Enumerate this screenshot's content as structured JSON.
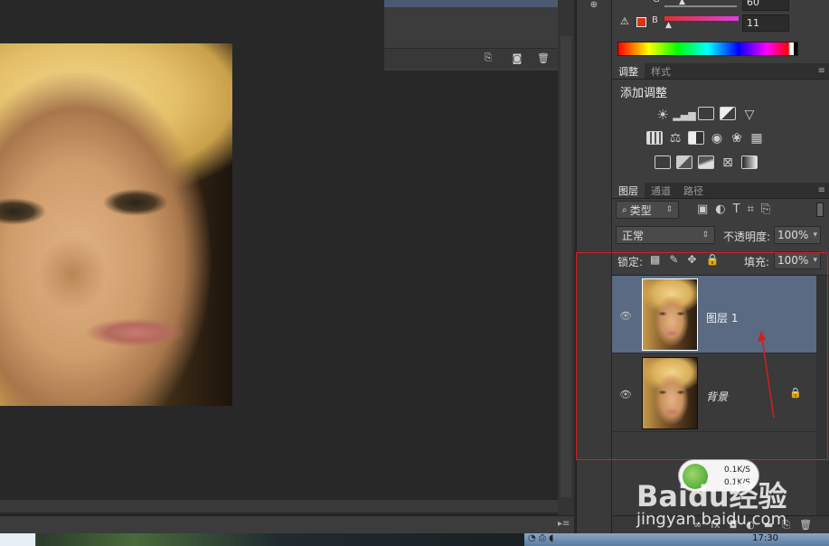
{
  "history_panel": {
    "icons": [
      "new-snapshot-icon",
      "camera-icon",
      "trash-icon"
    ]
  },
  "color_panel": {
    "g_label": "G",
    "g_value": "60",
    "b_label": "B",
    "b_value": "11"
  },
  "adjustments_panel": {
    "tabs": [
      "调整",
      "样式"
    ],
    "active_tab": "调整",
    "title": "添加调整"
  },
  "layers_panel": {
    "tabs": [
      "图层",
      "通道",
      "路径"
    ],
    "active_tab": "图层",
    "filter_kind": "类型",
    "blend_mode": "正常",
    "opacity_label": "不透明度:",
    "opacity_value": "100%",
    "lock_label": "锁定:",
    "fill_label": "填充:",
    "fill_value": "100%",
    "layers": [
      {
        "name": "图层 1",
        "selected": true,
        "visible": true,
        "locked": false
      },
      {
        "name": "背景",
        "selected": false,
        "visible": true,
        "locked": true
      }
    ]
  },
  "network_widget": {
    "up": "0.1K/S",
    "down": "0.1K/S"
  },
  "watermark": {
    "brand": "Baidu经验",
    "url": "jingyan.baidu.com"
  },
  "taskbar": {
    "clock": "17:30"
  },
  "colors": {
    "selection": "#596a82",
    "annotation_red": "#d02020",
    "panel_bg": "#3d3d3d"
  }
}
